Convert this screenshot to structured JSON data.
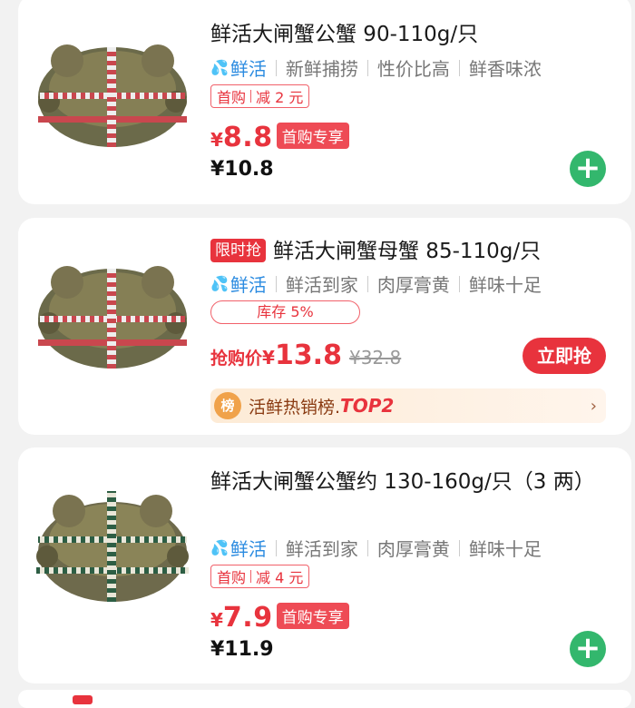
{
  "products": [
    {
      "title": "鲜活大闸蟹公蟹 90-110g/只",
      "fresh_label": "鲜活",
      "tags": [
        "新鲜捕捞",
        "性价比高",
        "鲜香味浓"
      ],
      "coupon_prefix": "首购",
      "coupon_text": "减 2 元",
      "price_symbol": "¥",
      "price": "8.8",
      "price_badge": "首购专享",
      "original_price": "¥10.8"
    },
    {
      "badge": "限时抢",
      "title": "鲜活大闸蟹母蟹 85-110g/只",
      "fresh_label": "鲜活",
      "tags": [
        "鲜活到家",
        "肉厚膏黄",
        "鲜味十足"
      ],
      "stock_text": "库存 5%",
      "price_label": "抢购价",
      "price_symbol": "¥",
      "price": "13.8",
      "strike_price": "¥32.8",
      "buy_label": "立即抢",
      "rank_icon": "榜",
      "rank_text": "活鲜热销榜.",
      "rank_top": "TOP2",
      "rank_arrow": "›"
    },
    {
      "title": "鲜活大闸蟹公蟹约 130-160g/只（3 两）",
      "fresh_label": "鲜活",
      "tags": [
        "鲜活到家",
        "肉厚膏黄",
        "鲜味十足"
      ],
      "coupon_prefix": "首购",
      "coupon_text": "减 4 元",
      "price_symbol": "¥",
      "price": "7.9",
      "price_badge": "首购专享",
      "original_price": "¥11.9"
    }
  ],
  "icons": {
    "add": "plus-icon",
    "fresh": "water-drops-icon",
    "rank": "rank-badge-icon",
    "arrow": "chevron-right-icon"
  },
  "colors": {
    "price_red": "#e8333d",
    "add_green": "#33b76d",
    "fresh_blue": "#2b8be0"
  }
}
